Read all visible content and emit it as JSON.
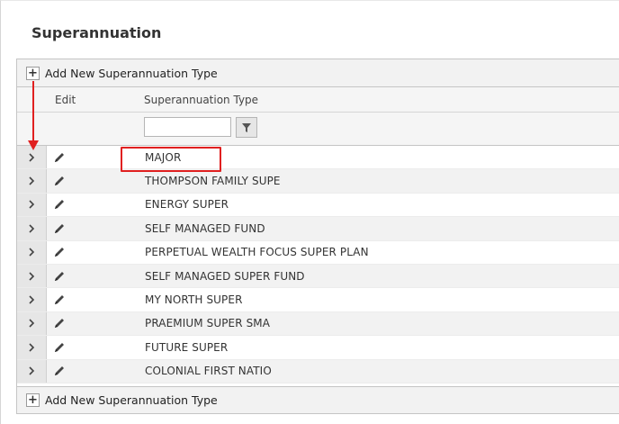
{
  "page": {
    "title": "Superannuation"
  },
  "toolbar": {
    "add_label": "Add New Superannuation Type",
    "add_icon": "plus-icon"
  },
  "columns": {
    "edit": "Edit",
    "type": "Superannuation Type"
  },
  "filter": {
    "value": "",
    "icon": "filter-icon"
  },
  "rows": [
    {
      "type": "MAJOR"
    },
    {
      "type": "THOMPSON FAMILY SUPE"
    },
    {
      "type": "ENERGY SUPER"
    },
    {
      "type": "SELF MANAGED FUND"
    },
    {
      "type": "PERPETUAL WEALTH FOCUS SUPER PLAN"
    },
    {
      "type": "SELF MANAGED SUPER FUND"
    },
    {
      "type": "MY NORTH SUPER"
    },
    {
      "type": "PRAEMIUM SUPER SMA"
    },
    {
      "type": "FUTURE SUPER"
    },
    {
      "type": "COLONIAL FIRST NATIO"
    }
  ],
  "colors": {
    "annotation": "#e02020",
    "row_alt": "#f2f2f2",
    "toolbar": "#f2f2f2"
  }
}
